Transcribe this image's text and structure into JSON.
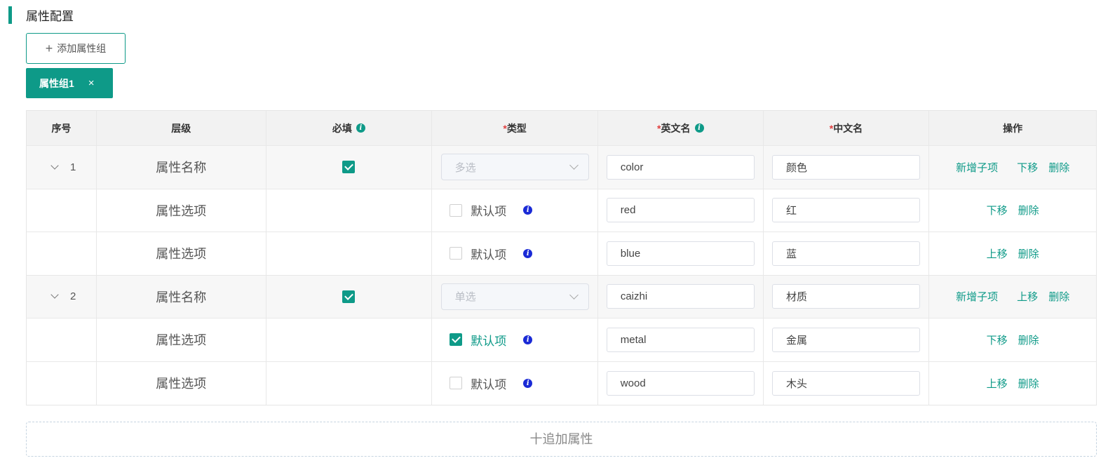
{
  "section": {
    "title": "属性配置"
  },
  "add_group": {
    "icon": "+",
    "label": "添加属性组"
  },
  "group_tab": {
    "label": "属性组1",
    "close": "×"
  },
  "table": {
    "headers": {
      "seq": "序号",
      "level": "层级",
      "required": "必填",
      "type_star": "*",
      "type": "类型",
      "en_star": "*",
      "en_name": "英文名",
      "cn_star": "*",
      "cn_name": "中文名",
      "ops": "操作"
    },
    "info_glyph": "i",
    "rows": [
      {
        "seq": "1",
        "level": "属性名称",
        "required": true,
        "type": "多选",
        "en": "color",
        "cn": "颜色",
        "op1": "新增子项",
        "op2": "下移",
        "op3": "删除"
      },
      {
        "level": "属性选项",
        "default_label": "默认项",
        "default_checked": false,
        "en": "red",
        "cn": "红",
        "op1": "下移",
        "op2": "删除"
      },
      {
        "level": "属性选项",
        "default_label": "默认项",
        "default_checked": false,
        "en": "blue",
        "cn": "蓝",
        "op1": "上移",
        "op2": "删除"
      },
      {
        "seq": "2",
        "level": "属性名称",
        "required": true,
        "type": "单选",
        "en": "caizhi",
        "cn": "材质",
        "op1": "新增子项",
        "op2": "上移",
        "op3": "删除"
      },
      {
        "level": "属性选项",
        "default_label": "默认项",
        "default_checked": true,
        "en": "metal",
        "cn": "金属",
        "op1": "下移",
        "op2": "删除"
      },
      {
        "level": "属性选项",
        "default_label": "默认项",
        "default_checked": false,
        "en": "wood",
        "cn": "木头",
        "op1": "上移",
        "op2": "删除"
      }
    ]
  },
  "append": {
    "label": "十追加属性"
  },
  "colors": {
    "accent": "#0e9a88",
    "required": "#e04040",
    "info_blue": "#1a2ad6"
  }
}
